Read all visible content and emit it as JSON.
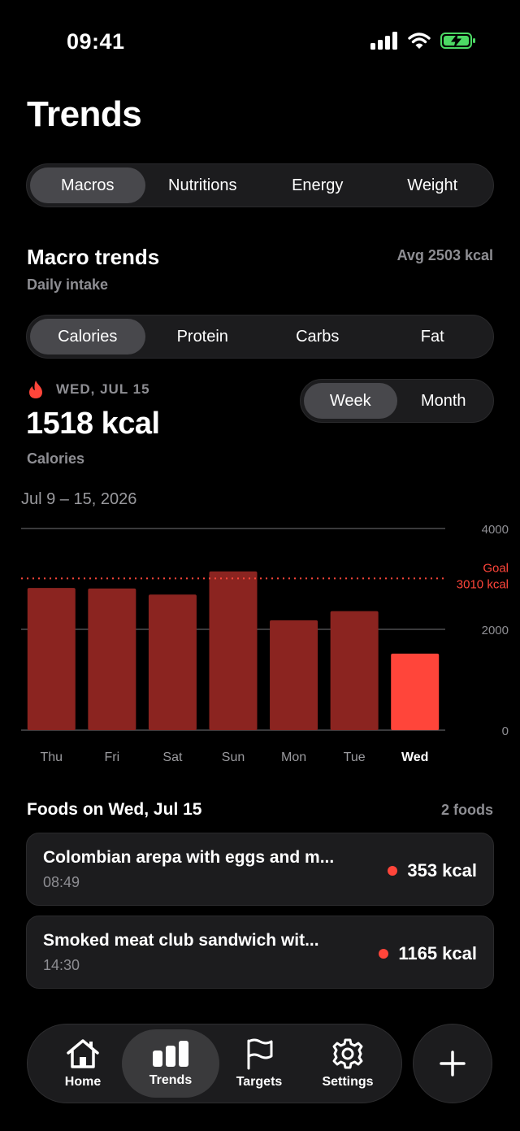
{
  "status": {
    "time": "09:41"
  },
  "title": "Trends",
  "main_tabs": [
    {
      "label": "Macros",
      "active": true
    },
    {
      "label": "Nutritions",
      "active": false
    },
    {
      "label": "Energy",
      "active": false
    },
    {
      "label": "Weight",
      "active": false
    }
  ],
  "section": {
    "title": "Macro trends",
    "subtitle": "Daily intake",
    "average": "Avg 2503 kcal"
  },
  "metric_tabs": [
    {
      "label": "Calories",
      "active": true
    },
    {
      "label": "Protein",
      "active": false
    },
    {
      "label": "Carbs",
      "active": false
    },
    {
      "label": "Fat",
      "active": false
    }
  ],
  "selection": {
    "date": "WED, JUL 15",
    "value": "1518 kcal",
    "label": "Calories"
  },
  "range_tabs": [
    {
      "label": "Week",
      "active": true
    },
    {
      "label": "Month",
      "active": false
    }
  ],
  "date_range": "Jul 9 – 15, 2026",
  "chart_data": {
    "type": "bar",
    "categories": [
      "Thu",
      "Fri",
      "Sat",
      "Sun",
      "Mon",
      "Tue",
      "Wed"
    ],
    "values": [
      2820,
      2810,
      2690,
      3150,
      2180,
      2360,
      1518
    ],
    "selected_index": 6,
    "ylim": [
      0,
      4000
    ],
    "y_ticks": [
      "0",
      "2000",
      "4000"
    ],
    "goal": 3010,
    "goal_label": "Goal",
    "goal_value_label": "3010 kcal",
    "colors": {
      "bar": "#8b2420",
      "selected": "#ff453a",
      "goal": "#ff453a"
    }
  },
  "foods": {
    "title": "Foods on Wed, Jul 15",
    "count": "2 foods",
    "items": [
      {
        "name": "Colombian arepa with eggs and m...",
        "time": "08:49",
        "kcal": "353 kcal"
      },
      {
        "name": "Smoked meat club sandwich wit...",
        "time": "14:30",
        "kcal": "1165 kcal"
      }
    ]
  },
  "tabbar": {
    "items": [
      {
        "label": "Home",
        "icon": "house-icon"
      },
      {
        "label": "Trends",
        "icon": "bar-chart-icon",
        "active": true
      },
      {
        "label": "Targets",
        "icon": "flag-icon"
      },
      {
        "label": "Settings",
        "icon": "gear-icon"
      }
    ],
    "add_icon": "plus-icon"
  }
}
